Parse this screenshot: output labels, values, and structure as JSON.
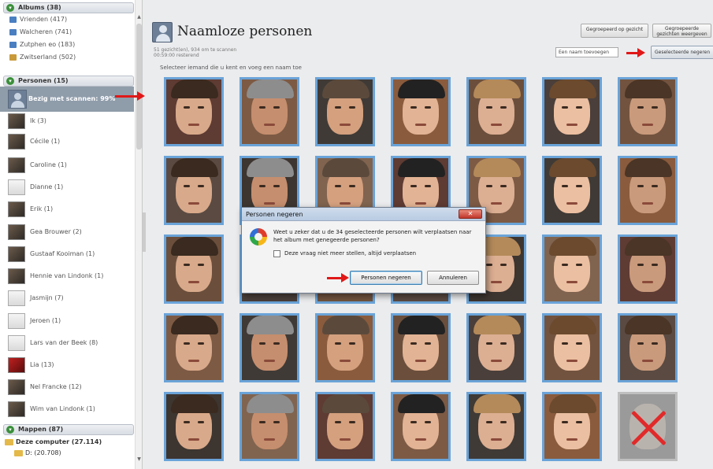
{
  "sidebar": {
    "albums_header": "Albums (38)",
    "albums": [
      {
        "label": "Vrienden (417)"
      },
      {
        "label": "Walcheren (741)"
      },
      {
        "label": "Zutphen eo (183)"
      },
      {
        "label": "Zwitserland (502)"
      }
    ],
    "persons_header": "Personen (15)",
    "persons": [
      {
        "label": "Bezig met scannen: 99%"
      },
      {
        "label": "Ik (3)"
      },
      {
        "label": "Cécile (1)"
      },
      {
        "label": "Caroline (1)"
      },
      {
        "label": "Dianne (1)"
      },
      {
        "label": "Erik (1)"
      },
      {
        "label": "Gea Brouwer (2)"
      },
      {
        "label": "Gustaaf Kooiman (1)"
      },
      {
        "label": "Hennie van Lindonk (1)"
      },
      {
        "label": "Jasmijn (7)"
      },
      {
        "label": "Jeroen (1)"
      },
      {
        "label": "Lars van der Beek (8)"
      },
      {
        "label": "Lia (13)"
      },
      {
        "label": "Nel Francke (12)"
      },
      {
        "label": "Wim van Lindonk (1)"
      }
    ],
    "folders_header": "Mappen (87)",
    "folders": [
      {
        "label": "Deze computer (27.114)"
      },
      {
        "label": "D: (20.708)"
      }
    ]
  },
  "main": {
    "title": "Naamloze personen",
    "stats_line1": "51 gezicht(en), 934 om te scannen",
    "stats_line2": "00:59:00 resterend",
    "instruction": "Selecteer iemand die u kent en voeg een naam toe",
    "btn_grouped": "Gegroepeerd op gezicht",
    "btn_grouped_faces": "Gegroepeerde gezichten weergeven",
    "name_input_value": "Een naam toevoegen",
    "btn_ignore_selected": "Geselecteerde negeren",
    "faces_count": 35,
    "ignored_face_index": 34
  },
  "dialog": {
    "title": "Personen negeren",
    "close_label": "✕",
    "message": "Weet u zeker dat u de 34 geselecteerde personen wilt verplaatsen naar het album met genegeerde personen?",
    "checkbox_label": "Deze vraag niet meer stellen, altijd verplaatsen",
    "checkbox_checked": false,
    "ok_label": "Personen negeren",
    "cancel_label": "Annuleren"
  },
  "colors": {
    "selection_border": "#6aa3d8",
    "annotation_arrow": "#e01818"
  },
  "icons": {
    "dialog": "photo-gallery-icon",
    "title": "person-icon"
  }
}
